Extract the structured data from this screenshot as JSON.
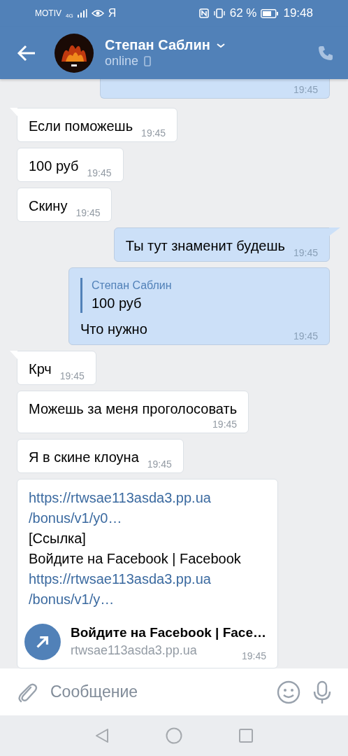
{
  "status_bar": {
    "carrier": "MOTIV",
    "network": "4G",
    "left_glyph": "Я",
    "battery_text": "62 %",
    "time": "19:48"
  },
  "header": {
    "name": "Степан Саблин",
    "status": "online"
  },
  "messages": [
    {
      "kind": "text",
      "outgoing": true,
      "tail": false,
      "time": "19:45",
      "clipped_top": true
    },
    {
      "kind": "text",
      "outgoing": false,
      "tail": true,
      "text": "Если поможешь",
      "time": "19:45"
    },
    {
      "kind": "text",
      "outgoing": false,
      "tail": false,
      "text": "100 руб",
      "time": "19:45"
    },
    {
      "kind": "text",
      "outgoing": false,
      "tail": false,
      "text": "Скину",
      "time": "19:45"
    },
    {
      "kind": "text",
      "outgoing": true,
      "tail": true,
      "text": "Ты тут знаменит будешь",
      "time": "19:45"
    },
    {
      "kind": "reply",
      "outgoing": true,
      "tail": false,
      "quote_author": "Степан Саблин",
      "quote_text": "100 руб",
      "text": "Что нужно",
      "time": "19:45"
    },
    {
      "kind": "text",
      "outgoing": false,
      "tail": true,
      "text": "Крч",
      "time": "19:45"
    },
    {
      "kind": "text",
      "outgoing": false,
      "tail": false,
      "text": "Можешь за меня проголосовать",
      "time": "19:45",
      "time_below": true
    },
    {
      "kind": "text",
      "outgoing": false,
      "tail": false,
      "text": "Я в скине клоуна",
      "time": "19:45"
    },
    {
      "kind": "link",
      "outgoing": false,
      "tail": false,
      "lines": [
        {
          "kind": "link",
          "text": "https://rtwsae113asda3.pp.ua"
        },
        {
          "kind": "link",
          "text": "/bonus/v1/y0…"
        },
        {
          "kind": "plain",
          "text": "[Ссылка]"
        },
        {
          "kind": "plain",
          "text": "Войдите на Facebook | Facebook"
        },
        {
          "kind": "link",
          "text": "https://rtwsae113asda3.pp.ua"
        },
        {
          "kind": "link",
          "text": "/bonus/v1/y…"
        }
      ],
      "preview_title": "Войдите на Facebook | Face…",
      "preview_domain": "rtwsae113asda3.pp.ua",
      "time": "19:45"
    }
  ],
  "composer": {
    "placeholder": "Сообщение"
  }
}
